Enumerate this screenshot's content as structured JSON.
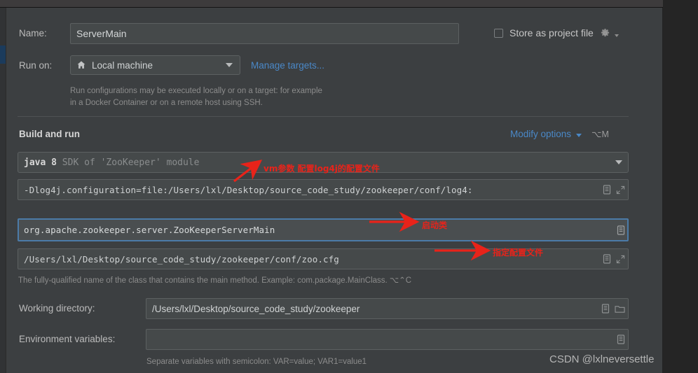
{
  "window": {
    "titlebar_present": true
  },
  "form": {
    "name_label": "Name:",
    "name_value": "ServerMain",
    "store_as_project_file_label": "Store as project file",
    "store_as_project_file_checked": false,
    "run_on_label": "Run on:",
    "run_on_value": "Local machine",
    "manage_targets_link": "Manage targets...",
    "run_on_hint_line1": "Run configurations may be executed locally or on a target: for example",
    "run_on_hint_line2": "in a Docker Container or on a remote host using SSH."
  },
  "build_and_run": {
    "section_title": "Build and run",
    "modify_options_label": "Modify options",
    "modify_options_shortcut": "⌥M",
    "sdk_bold": "java 8",
    "sdk_rest": "SDK of 'ZooKeeper' module",
    "vm_options_value": "-Dlog4j.configuration=file:/Users/lxl/Desktop/source_code_study/zookeeper/conf/log4:",
    "main_class_value": "org.apache.zookeeper.server.ZooKeeperServerMain",
    "program_args_value": "/Users/lxl/Desktop/source_code_study/zookeeper/conf/zoo.cfg",
    "main_class_hint": "The fully-qualified name of the class that contains the main method. Example: com.package.MainClass. ⌥⌃C"
  },
  "working_directory": {
    "label": "Working directory:",
    "value": "/Users/lxl/Desktop/source_code_study/zookeeper"
  },
  "environment_variables": {
    "label": "Environment variables:",
    "value": "",
    "hint": "Separate variables with semicolon: VAR=value; VAR1=value1"
  },
  "annotations": [
    {
      "text": "vm参数 配置log4j的配置文件"
    },
    {
      "text": "启动类"
    },
    {
      "text": "指定配置文件"
    }
  ],
  "watermark": "CSDN @lxlneversettle",
  "icons": {
    "home": "home-icon",
    "chevron_down": "chevron-down-icon",
    "gear": "gear-icon",
    "macro": "macro-list-icon",
    "expand": "expand-icon",
    "folder": "folder-icon"
  },
  "colors": {
    "dialog_bg": "#3c3f41",
    "field_bg": "#45494a",
    "accent_link": "#4a88c7",
    "focus_border": "#4b7ba8",
    "annotation_red": "#e8231a"
  }
}
